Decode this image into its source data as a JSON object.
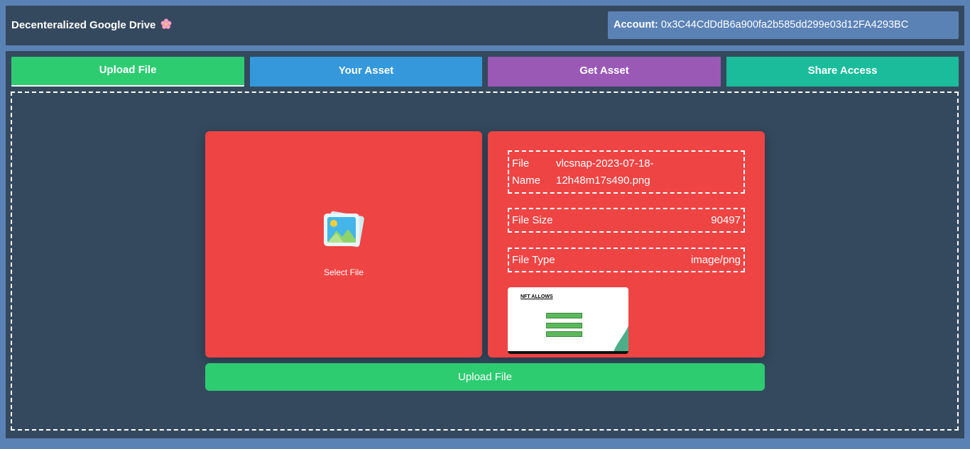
{
  "header": {
    "title": "Decenteralized Google Drive",
    "title_icon": "cherry-blossom-icon",
    "account_label": "Account:",
    "account_address": "0x3C44CdDdB6a900fa2b585dd299e03d12FA4293BC"
  },
  "tabs": [
    {
      "label": "Upload File",
      "color": "#2ecc71",
      "active": true
    },
    {
      "label": "Your Asset",
      "color": "#3498db"
    },
    {
      "label": "Get Asset",
      "color": "#9b59b6"
    },
    {
      "label": "Share Access",
      "color": "#1abc9c"
    }
  ],
  "upload": {
    "select_label": "Select File",
    "select_icon": "picture-icon",
    "file_info": {
      "name_label": "File Name",
      "name_value": "vlcsnap-2023-07-18-12h48m17s490.png",
      "size_label": "File Size",
      "size_value": "90497",
      "type_label": "File Type",
      "type_value": "image/png"
    },
    "preview_title": "NFT ALLOWS",
    "submit_label": "Upload File"
  },
  "colors": {
    "background": "#5b82b5",
    "panel": "#34495e",
    "card": "#ef4444",
    "success": "#2ecc71"
  }
}
